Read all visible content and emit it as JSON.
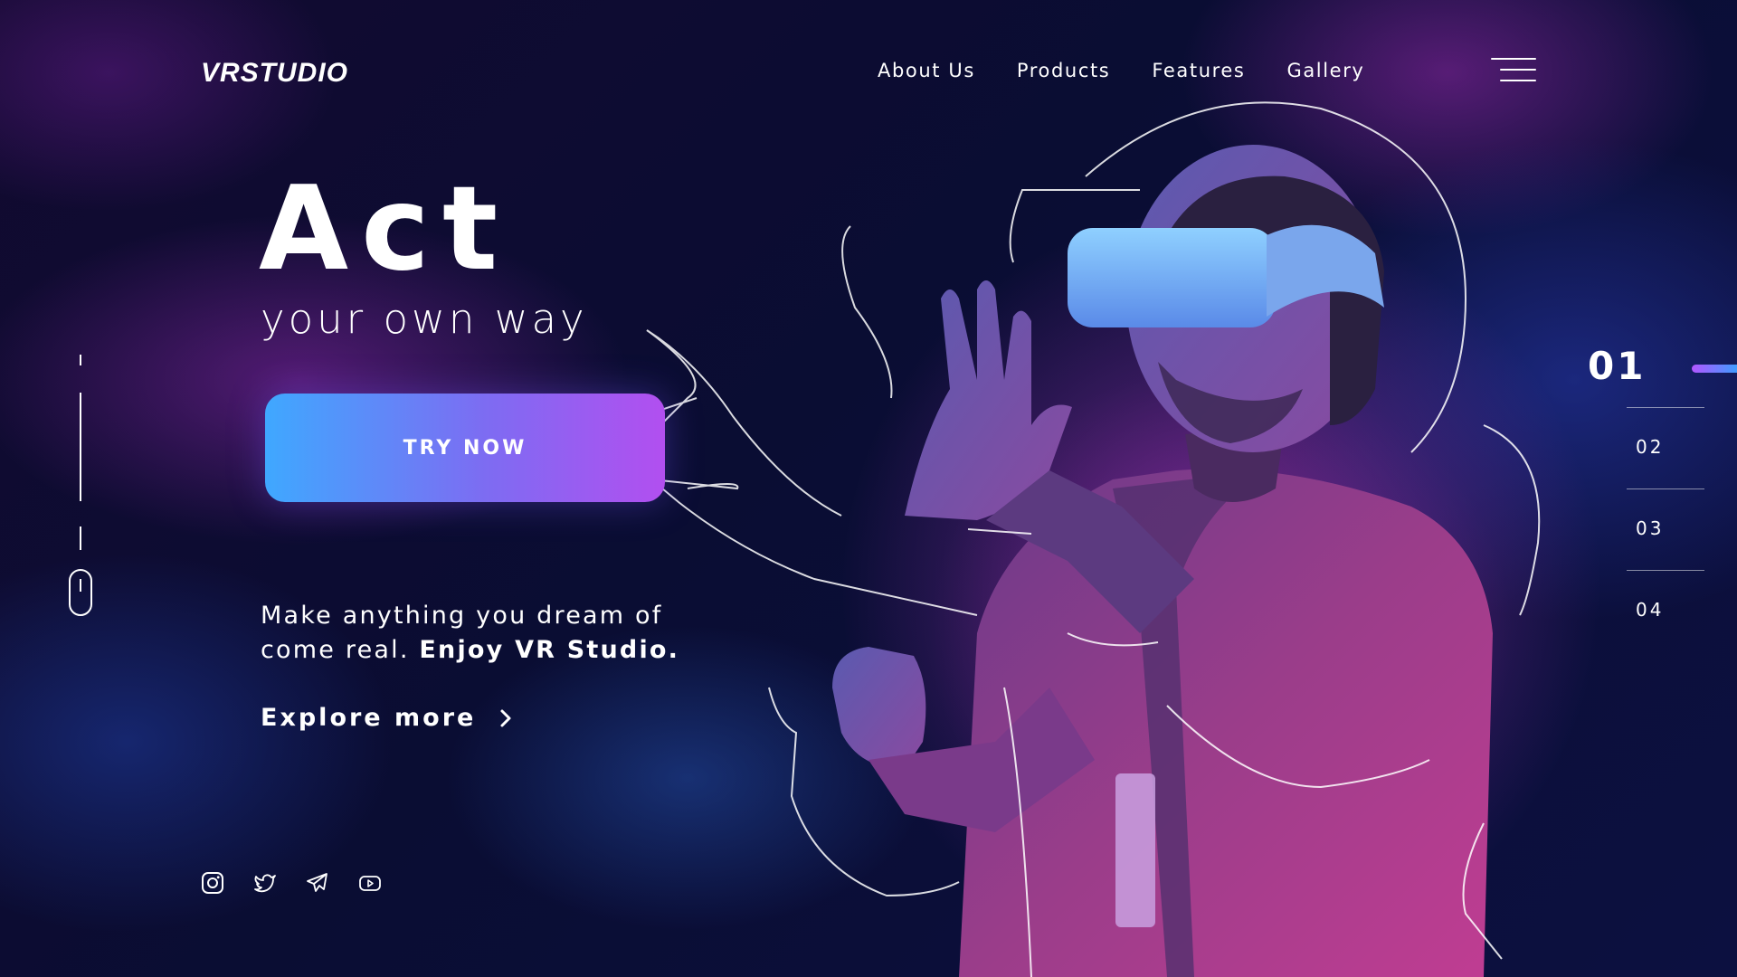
{
  "brand": {
    "logo_text": "VRSTUDIO"
  },
  "nav": {
    "items": [
      {
        "label": "About Us"
      },
      {
        "label": "Products"
      },
      {
        "label": "Features"
      },
      {
        "label": "Gallery"
      }
    ]
  },
  "hero": {
    "title": "Act",
    "subtitle": "your own way",
    "cta_label": "TRY NOW",
    "description_line1": "Make anything you dream of",
    "description_line2_prefix": "come real.",
    "description_line2_emphasis": "Enjoy VR Studio.",
    "explore_label": "Explore more"
  },
  "slides": {
    "active": "01",
    "items": [
      "02",
      "03",
      "04"
    ]
  },
  "socials": [
    "instagram-icon",
    "twitter-icon",
    "telegram-icon",
    "youtube-icon"
  ],
  "colors": {
    "background": "#0a0b2a",
    "accent_blue": "#3fa8ff",
    "accent_purple": "#b24ff0",
    "text": "#ffffff"
  }
}
